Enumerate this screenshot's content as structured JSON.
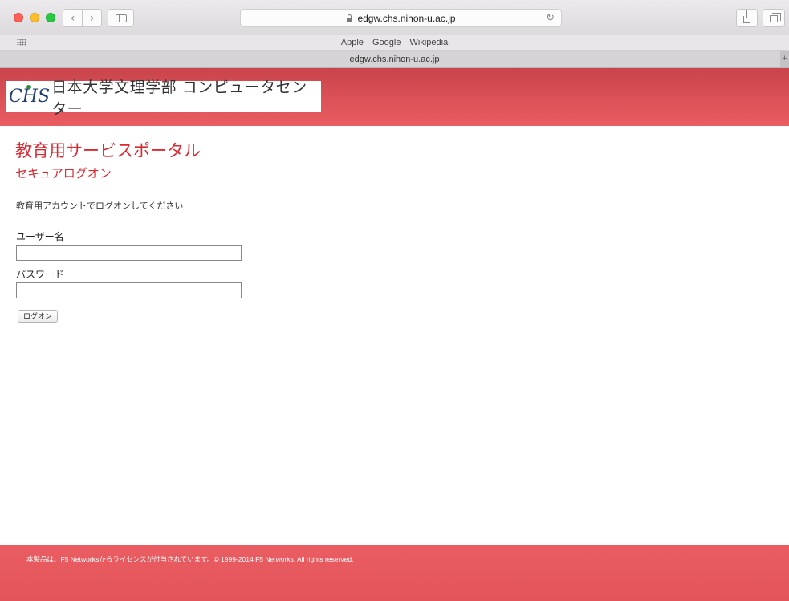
{
  "browser": {
    "url": "edgw.chs.nihon-u.ac.jp",
    "favorites": [
      "Apple",
      "Google",
      "Wikipedia"
    ],
    "tab_title": "edgw.chs.nihon-u.ac.jp",
    "new_tab": "+"
  },
  "icons": {
    "lock": "lock-icon",
    "reload": "↻"
  },
  "header": {
    "logo_mark": "CHS",
    "logo_text": "日本大学文理学部 コンピュータセンター"
  },
  "page": {
    "title": "教育用サービスポータル",
    "subtitle": "セキュアログオン",
    "instruction": "教育用アカウントでログオンしてください"
  },
  "form": {
    "username_label": "ユーザー名",
    "username_value": "",
    "password_label": "パスワード",
    "password_value": "",
    "logon_button": "ログオン"
  },
  "footer": {
    "text": "本製品は、F5 Networksからライセンスが付与されています。© 1999-2014 F5 Networks. All rights reserved."
  },
  "colors": {
    "brand_red": "#e6565c",
    "title_red": "#d92a33"
  }
}
